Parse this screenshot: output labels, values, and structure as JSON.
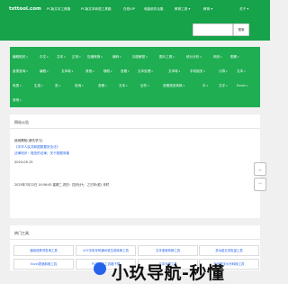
{
  "header": {
    "logo": "txttool.com",
    "nav": [
      "PC版文本工具箱",
      "PC版文本转语工具箱",
      "在线VIP",
      "电脑软件合集",
      "教育工具",
      "教育"
    ],
    "about": "关于",
    "search_placeholder": "",
    "search_button": "搜索"
  },
  "menu": {
    "rows": [
      [
        "编程相关",
        "中文",
        "文本",
        "正则",
        "压缩转换",
        "编码",
        "加密解密",
        "图片工具",
        "统计分析",
        "网页",
        "图像"
      ],
      [
        "各类查询",
        "编程",
        "文本转",
        "其他",
        "随机",
        "查看",
        "文本处理",
        "文本转",
        "手机相关",
        "计算",
        "文本"
      ],
      [
        "电表",
        "生成",
        "查",
        "查询",
        "查看",
        "文本",
        "证件",
        "查看语言转换",
        "中",
        "文字",
        "Excel"
      ],
      [
        "其他"
      ]
    ]
  },
  "notice": {
    "title": "网站公告",
    "lines": [
      "使用需知(请先学习)",
      "《中华人民共和国数据安全法》",
      "法律知识：爬虫的法律，关于数据采集",
      "2023.05.15"
    ],
    "date_line": "2025年7月22日 14:56:45 星期二 农历：四月廿七　乙巳年(蛇) 未时"
  },
  "hot_tools": {
    "title": "热门工具",
    "items": [
      "通用违禁词查询工具",
      "VCF手机号码通讯录生成转换工具",
      "文本语音转换工具",
      "多功能文本批量工具",
      "Excel表格转换工具",
      "PC版文本工具箱下载",
      "文本去重工具",
      "在线数字大写转换工具"
    ]
  },
  "scroll": {
    "up": "︿",
    "down": "﹀"
  },
  "watermark": "小玖导航-秒懂"
}
